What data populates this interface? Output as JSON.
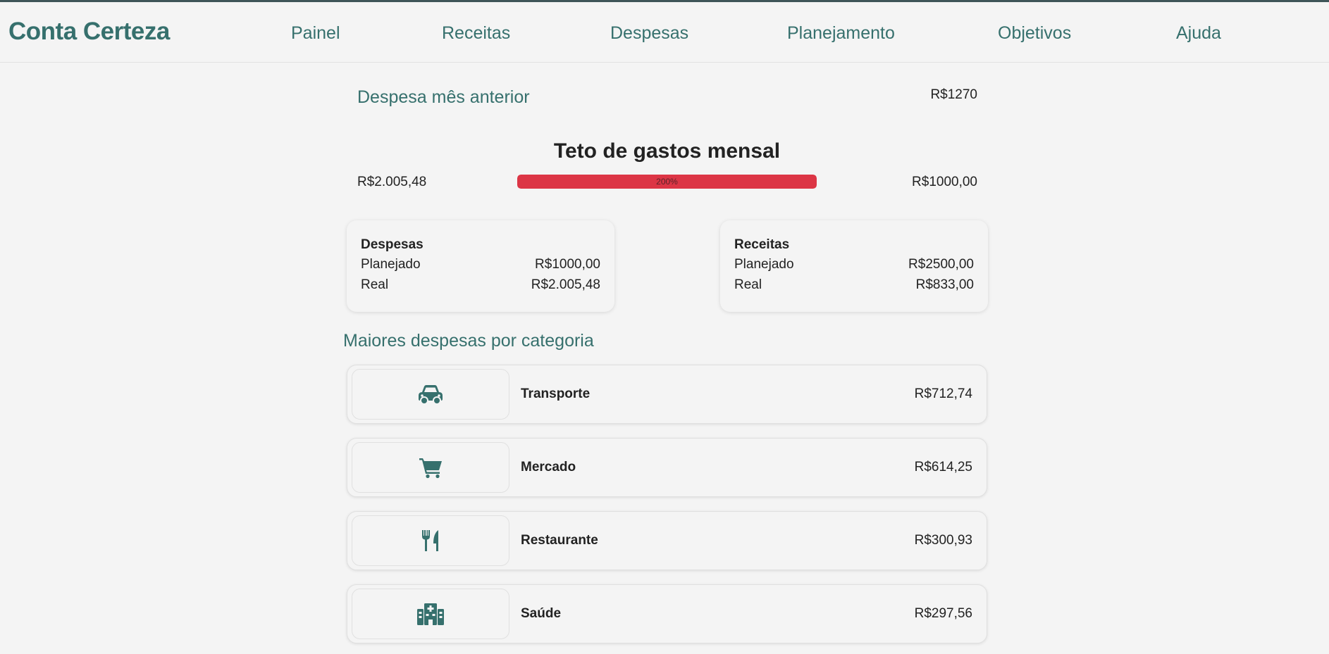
{
  "brand": "Conta Certeza",
  "nav": {
    "items": [
      {
        "label": "Painel"
      },
      {
        "label": "Receitas"
      },
      {
        "label": "Despesas"
      },
      {
        "label": "Planejamento"
      },
      {
        "label": "Objetivos"
      },
      {
        "label": "Ajuda"
      }
    ]
  },
  "previous_month": {
    "label": "Despesa mês anterior",
    "value": "R$1270"
  },
  "spending_ceiling": {
    "title": "Teto de gastos mensal",
    "spent": "R$2.005,48",
    "limit": "R$1000,00",
    "progress_label": "200%",
    "progress_fraction": 1.0,
    "bar_color": "#dc3545"
  },
  "summary": {
    "expenses": {
      "title": "Despesas",
      "planned_label": "Planejado",
      "planned_value": "R$1000,00",
      "real_label": "Real",
      "real_value": "R$2.005,48"
    },
    "income": {
      "title": "Receitas",
      "planned_label": "Planejado",
      "planned_value": "R$2500,00",
      "real_label": "Real",
      "real_value": "R$833,00"
    }
  },
  "categories": {
    "title": "Maiores despesas por categoria",
    "items": [
      {
        "name": "Transporte",
        "value": "R$712,74",
        "icon": "car-icon"
      },
      {
        "name": "Mercado",
        "value": "R$614,25",
        "icon": "shopping-cart-icon"
      },
      {
        "name": "Restaurante",
        "value": "R$300,93",
        "icon": "utensils-icon"
      },
      {
        "name": "Saúde",
        "value": "R$297,56",
        "icon": "hospital-icon"
      }
    ]
  },
  "colors": {
    "accent": "#36706d",
    "danger": "#dc3545",
    "background": "#f4f4f4"
  }
}
